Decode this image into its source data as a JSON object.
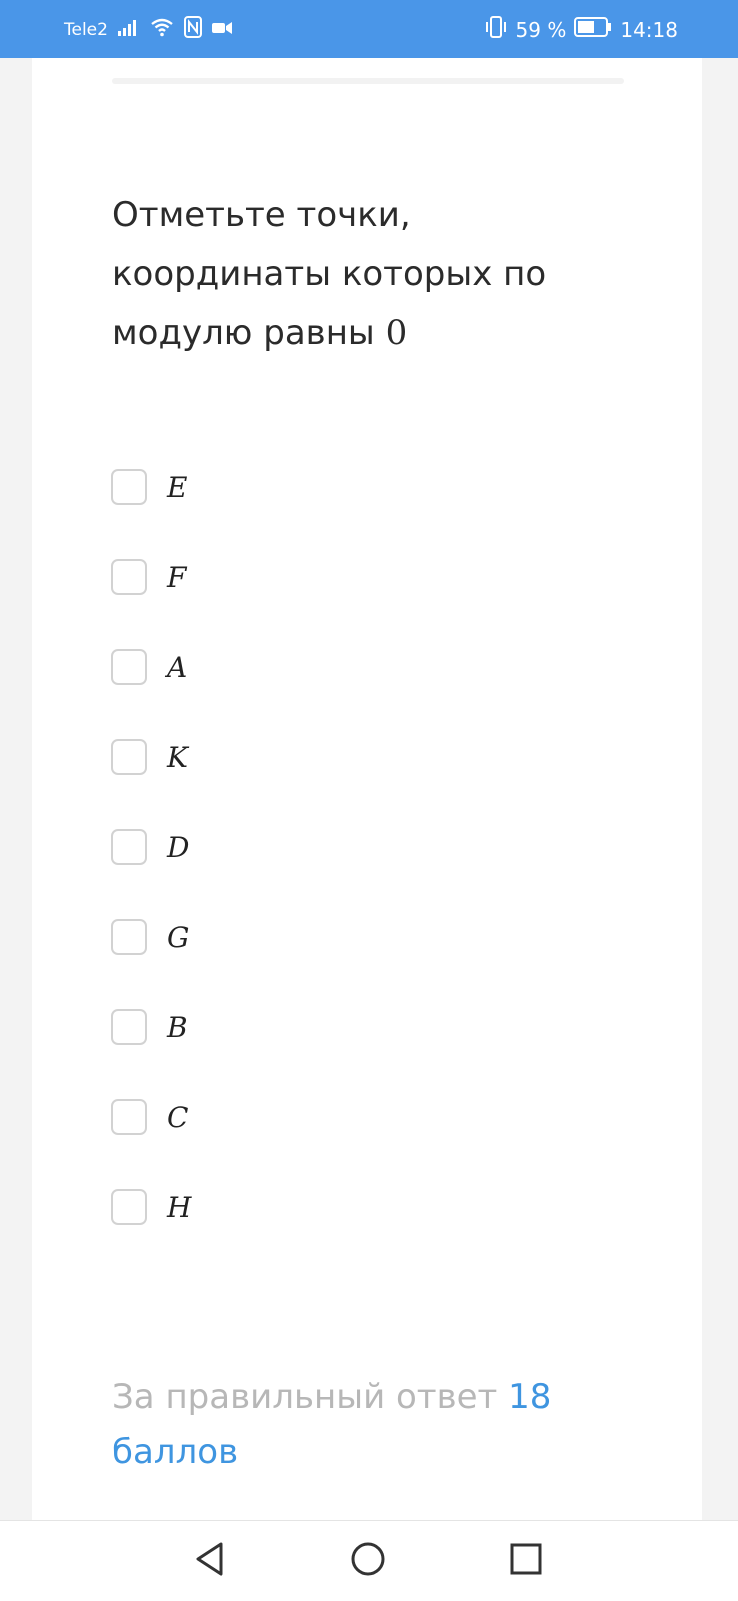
{
  "status_bar": {
    "carrier": "Tele2",
    "battery_percent": "59 %",
    "time": "14:18",
    "color": "#4a96e8",
    "icons": [
      "signal-icon",
      "wifi-icon",
      "nfc-icon",
      "video-icon",
      "vibrate-icon",
      "battery-icon"
    ]
  },
  "question": {
    "text": "Отметьте точки, координаты которых по модулю равны",
    "math": "0"
  },
  "options": [
    {
      "label": "E",
      "checked": false
    },
    {
      "label": "F",
      "checked": false
    },
    {
      "label": "A",
      "checked": false
    },
    {
      "label": "K",
      "checked": false
    },
    {
      "label": "D",
      "checked": false
    },
    {
      "label": "G",
      "checked": false
    },
    {
      "label": "B",
      "checked": false
    },
    {
      "label": "C",
      "checked": false
    },
    {
      "label": "H",
      "checked": false
    }
  ],
  "score": {
    "prefix": "За правильный ответ",
    "points": "18",
    "unit": "баллов",
    "accent_color": "#3f95e0"
  },
  "nav_bar": {
    "icons": [
      "back-triangle-icon",
      "home-circle-icon",
      "recents-square-icon"
    ]
  }
}
